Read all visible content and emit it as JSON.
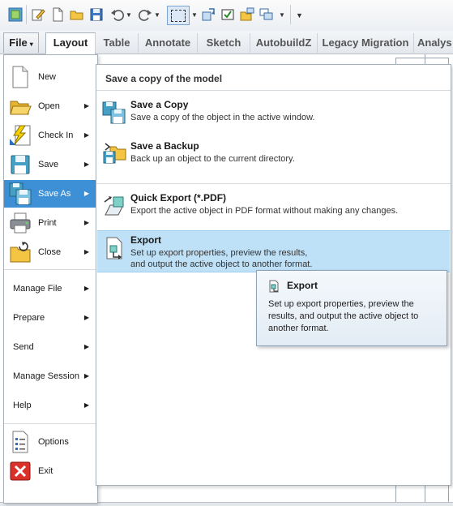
{
  "ribbon": {
    "file_label": "File",
    "tabs": [
      {
        "label": "Layout"
      },
      {
        "label": "Table"
      },
      {
        "label": "Annotate"
      },
      {
        "label": "Sketch"
      },
      {
        "label": "AutobuildZ"
      },
      {
        "label": "Legacy Migration"
      },
      {
        "label": "Analys"
      }
    ]
  },
  "file_menu": {
    "items": [
      {
        "label": "New",
        "icon": "new-document-icon",
        "submenu": false
      },
      {
        "label": "Open",
        "icon": "open-folder-icon",
        "submenu": true
      },
      {
        "label": "Check In",
        "icon": "check-in-icon",
        "submenu": true
      },
      {
        "label": "Save",
        "icon": "save-disk-icon",
        "submenu": true
      },
      {
        "label": "Save As",
        "icon": "save-as-icon",
        "submenu": true,
        "selected": true
      },
      {
        "label": "Print",
        "icon": "printer-icon",
        "submenu": true
      },
      {
        "label": "Close",
        "icon": "close-folder-icon",
        "submenu": true
      }
    ],
    "text_items": [
      {
        "label": "Manage File"
      },
      {
        "label": "Prepare"
      },
      {
        "label": "Send"
      },
      {
        "label": "Manage Session"
      },
      {
        "label": "Help"
      }
    ],
    "bottom_items": [
      {
        "label": "Options",
        "icon": "options-list-icon"
      },
      {
        "label": "Exit",
        "icon": "exit-x-icon"
      }
    ]
  },
  "save_as_menu": {
    "heading": "Save a copy of the model",
    "options": [
      {
        "title": "Save a Copy",
        "desc": "Save a copy of the object in the active window."
      },
      {
        "title": "Save a Backup",
        "desc": "Back up an object to the current directory."
      },
      {
        "title": "Quick Export (*.PDF)",
        "desc": "Export the active object in PDF format without making any changes."
      },
      {
        "title": "Export",
        "desc": "Set up export properties, preview the results,\nand output the active object to another format."
      }
    ]
  },
  "tooltip": {
    "title": "Export",
    "desc": "Set up export properties, preview the results, and output the active object to another format."
  },
  "colors": {
    "selected": "#3d8fd6",
    "highlight": "#bfe1f7",
    "exit_red": "#d9302a"
  }
}
